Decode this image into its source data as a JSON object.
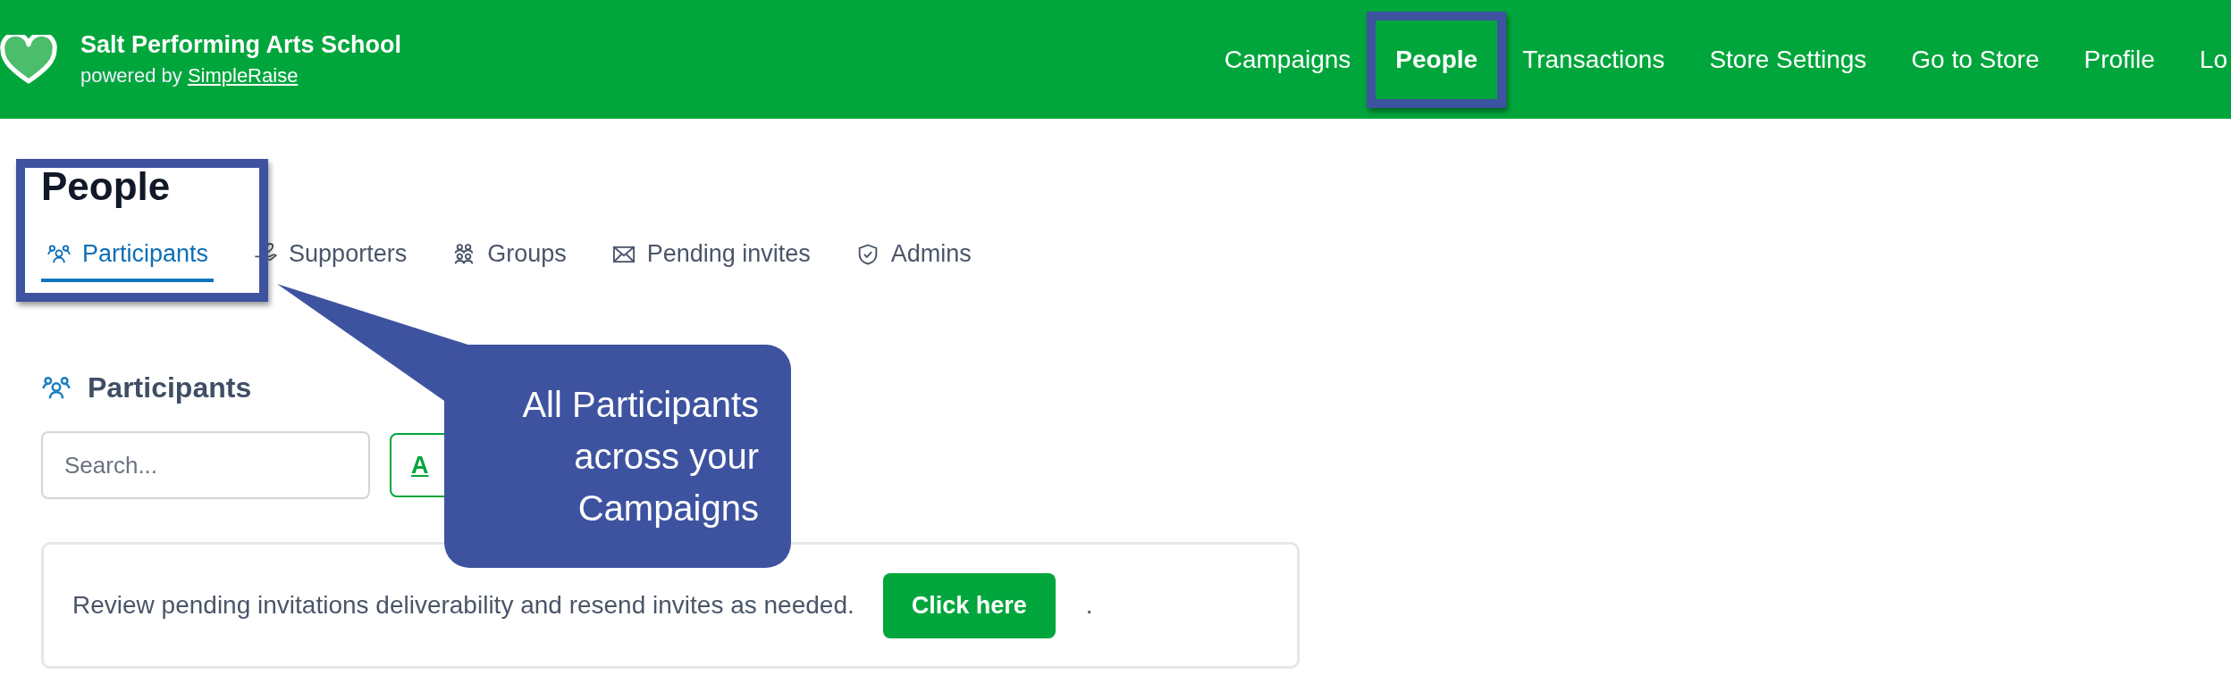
{
  "header": {
    "org_name": "Salt Performing Arts School",
    "powered_by": "powered by",
    "powered_link": "SimpleRaise"
  },
  "nav": [
    {
      "label": "Campaigns",
      "selected": false
    },
    {
      "label": "People",
      "selected": true
    },
    {
      "label": "Transactions",
      "selected": false
    },
    {
      "label": "Store Settings",
      "selected": false
    },
    {
      "label": "Go to Store",
      "selected": false
    },
    {
      "label": "Profile",
      "selected": false
    },
    {
      "label": "Lo",
      "selected": false
    }
  ],
  "page_title": "People",
  "tabs": [
    {
      "label": "Participants",
      "selected": true
    },
    {
      "label": "Supporters",
      "selected": false
    },
    {
      "label": "Groups",
      "selected": false
    },
    {
      "label": "Pending invites",
      "selected": false
    },
    {
      "label": "Admins",
      "selected": false
    }
  ],
  "section_title": "Participants",
  "search": {
    "placeholder": "Search..."
  },
  "add_button": "A",
  "banner": {
    "text": "Review pending invitations deliverability and resend invites as needed.",
    "button": "Click here",
    "trailing": "."
  },
  "callout": "All Participants across your Campaigns"
}
